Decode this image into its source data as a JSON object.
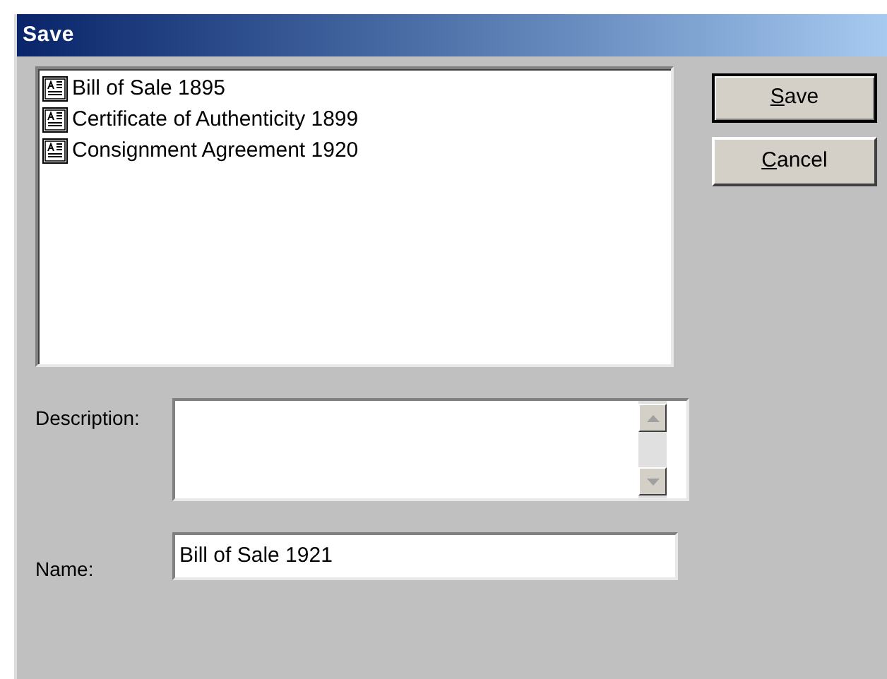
{
  "window": {
    "title": "Save"
  },
  "documents": [
    {
      "name": "Bill of Sale 1895"
    },
    {
      "name": "Certificate of Authenticity 1899"
    },
    {
      "name": "Consignment Agreement 1920"
    }
  ],
  "description": {
    "label": "Description:"
  },
  "name_field": {
    "label": "Name:",
    "value": "Bill of Sale 1921"
  },
  "buttons": [
    {
      "label": "Save",
      "default": true,
      "underline_first": true
    },
    {
      "label": "Cancel",
      "default": false,
      "underline_first": true
    }
  ]
}
